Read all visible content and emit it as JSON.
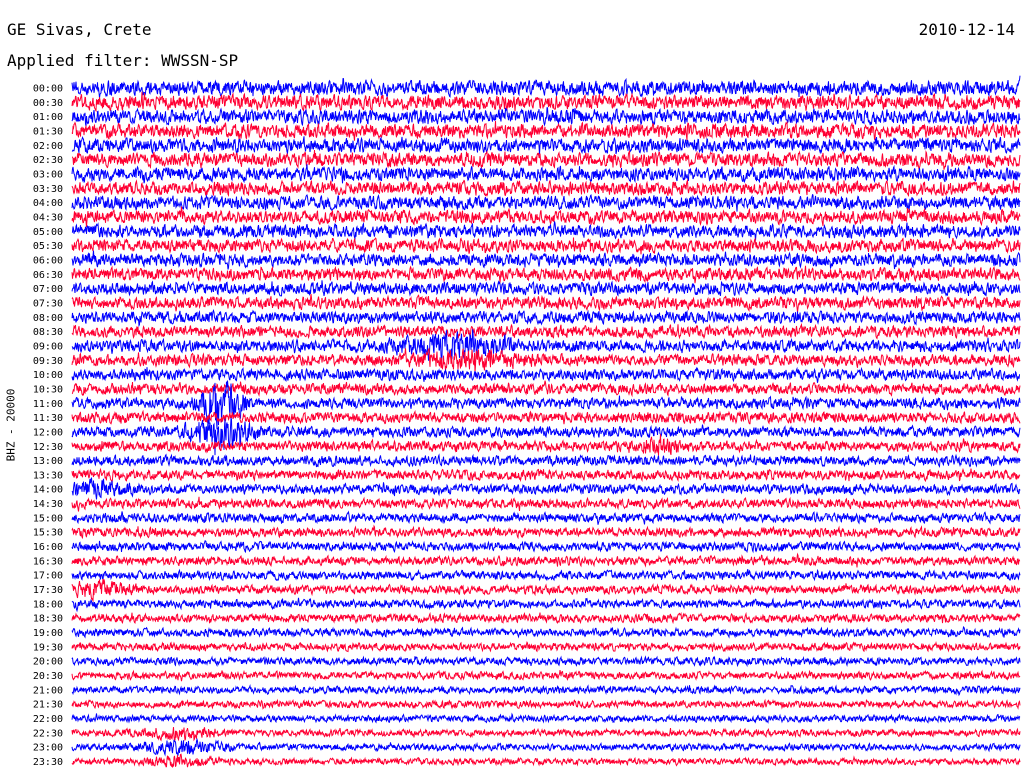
{
  "header": {
    "station": "GE Sivas, Crete",
    "date": "2010-12-14",
    "filter": "Applied filter: WWSSN-SP"
  },
  "chart_data": {
    "type": "line",
    "title": "GE Sivas, Crete",
    "subtitle": "Applied filter: WWSSN-SP",
    "date": "2010-12-14",
    "ylabel": "BHZ - 20000",
    "xlabel": "",
    "row_labels": [
      "00:00",
      "00:30",
      "01:00",
      "01:30",
      "02:00",
      "02:30",
      "03:00",
      "03:30",
      "04:00",
      "04:30",
      "05:00",
      "05:30",
      "06:00",
      "06:30",
      "07:00",
      "07:30",
      "08:00",
      "08:30",
      "09:00",
      "09:30",
      "10:00",
      "10:30",
      "11:00",
      "11:30",
      "12:00",
      "12:30",
      "13:00",
      "13:30",
      "14:00",
      "14:30",
      "15:00",
      "15:30",
      "16:00",
      "16:30",
      "17:00",
      "17:30",
      "18:00",
      "18:30",
      "19:00",
      "19:30",
      "20:00",
      "20:30",
      "21:00",
      "21:30",
      "22:00",
      "22:30",
      "23:00",
      "23:30"
    ],
    "row_minutes": 30,
    "row_colors": [
      "#0000ff",
      "#ff0033"
    ],
    "events": [
      {
        "row": "09:00",
        "minute": 12,
        "amplitude": 2.8,
        "duration_min": 2.5
      },
      {
        "row": "09:30",
        "minute": 12.5,
        "amplitude": 2.2,
        "duration_min": 2.5
      },
      {
        "row": "11:00",
        "minute": 4.7,
        "amplitude": 5,
        "duration_min": 1
      },
      {
        "row": "12:00",
        "minute": 4.7,
        "amplitude": 3.5,
        "duration_min": 1.5
      },
      {
        "row": "12:30",
        "minute": 18.6,
        "amplitude": 2.6,
        "duration_min": 0.8
      },
      {
        "row": "14:00",
        "minute": 0.8,
        "amplitude": 2.2,
        "duration_min": 1.5
      },
      {
        "row": "17:30",
        "minute": 0.8,
        "amplitude": 2.6,
        "duration_min": 1.5
      },
      {
        "row": "22:30",
        "minute": 3.3,
        "amplitude": 2.4,
        "duration_min": 1.8
      },
      {
        "row": "23:00",
        "minute": 3.4,
        "amplitude": 2.8,
        "duration_min": 2
      },
      {
        "row": "23:30",
        "minute": 3.4,
        "amplitude": 2.4,
        "duration_min": 1.4
      }
    ]
  }
}
